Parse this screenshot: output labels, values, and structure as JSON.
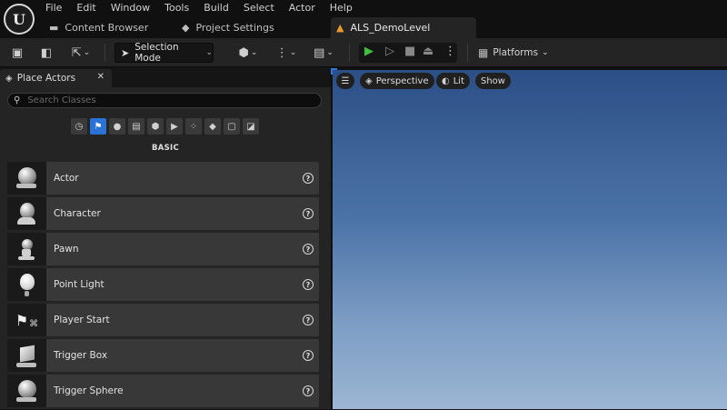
{
  "menu": [
    "File",
    "Edit",
    "Window",
    "Tools",
    "Build",
    "Select",
    "Actor",
    "Help"
  ],
  "tabs": {
    "content_browser": "Content Browser",
    "project_settings": "Project Settings",
    "level": "ALS_DemoLevel"
  },
  "toolbar": {
    "mode_label": "Selection Mode",
    "platforms_label": "Platforms"
  },
  "panel": {
    "title": "Place Actors",
    "search_placeholder": "Search Classes",
    "category_label": "BASIC",
    "items": [
      {
        "label": "Actor",
        "icon": "actor-icon"
      },
      {
        "label": "Character",
        "icon": "character-icon"
      },
      {
        "label": "Pawn",
        "icon": "pawn-icon"
      },
      {
        "label": "Point Light",
        "icon": "point-light-icon"
      },
      {
        "label": "Player Start",
        "icon": "player-start-icon"
      },
      {
        "label": "Trigger Box",
        "icon": "trigger-box-icon"
      },
      {
        "label": "Trigger Sphere",
        "icon": "trigger-sphere-icon"
      }
    ]
  },
  "viewport": {
    "perspective": "Perspective",
    "lit": "Lit",
    "show": "Show"
  },
  "colors": {
    "accent": "#2a72d8",
    "play_green": "#3fbf3f",
    "level_tab_icon": "#e79a2e"
  }
}
